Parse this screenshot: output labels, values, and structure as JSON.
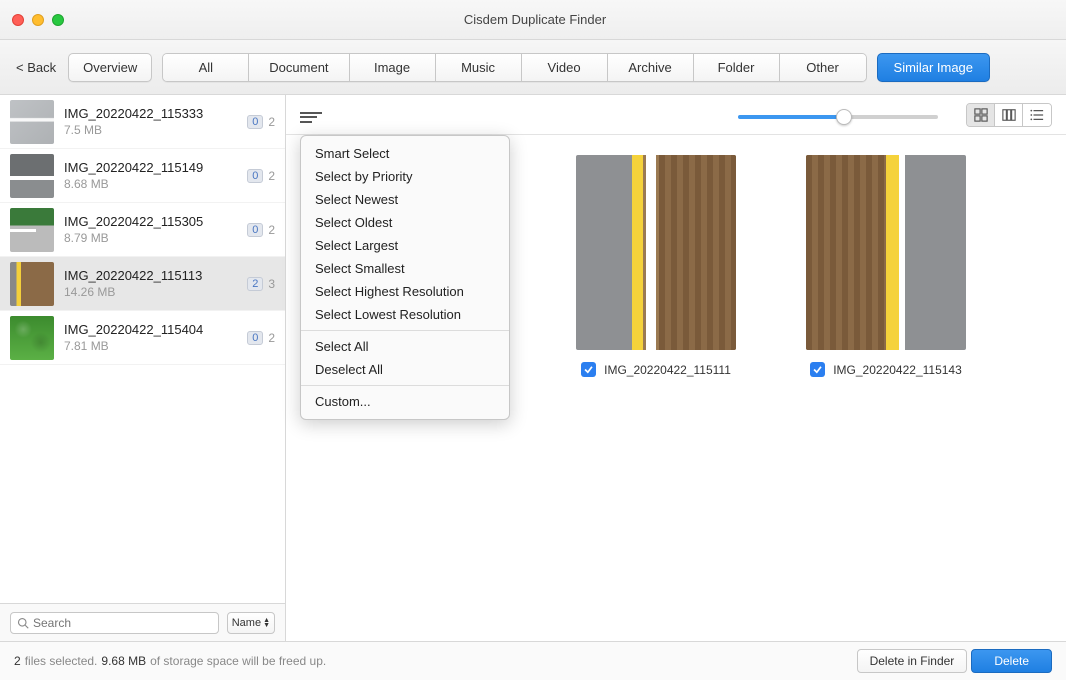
{
  "window": {
    "title": "Cisdem Duplicate Finder"
  },
  "toolbar": {
    "back": "< Back",
    "overview": "Overview",
    "tabs": [
      "All",
      "Document",
      "Image",
      "Music",
      "Video",
      "Archive",
      "Folder",
      "Other"
    ],
    "similar_image": "Similar Image"
  },
  "sidebar": {
    "items": [
      {
        "name": "IMG_20220422_115333",
        "size": "7.5 MB",
        "selected": "0",
        "total": "2"
      },
      {
        "name": "IMG_20220422_115149",
        "size": "8.68 MB",
        "selected": "0",
        "total": "2"
      },
      {
        "name": "IMG_20220422_115305",
        "size": "8.79 MB",
        "selected": "0",
        "total": "2"
      },
      {
        "name": "IMG_20220422_115113",
        "size": "14.26 MB",
        "selected": "2",
        "total": "3"
      },
      {
        "name": "IMG_20220422_115404",
        "size": "7.81 MB",
        "selected": "0",
        "total": "2"
      }
    ],
    "search_placeholder": "Search",
    "sort_label": "Name"
  },
  "dropdown": {
    "items": [
      "Smart Select",
      "Select by Priority",
      "Select Newest",
      "Select Oldest",
      "Select Largest",
      "Select Smallest",
      "Select Highest Resolution",
      "Select Lowest Resolution"
    ],
    "items2": [
      "Select All",
      "Deselect All"
    ],
    "items3": [
      "Custom..."
    ]
  },
  "grid": {
    "cards": [
      {
        "filename": "IMG_20220422_115111",
        "checked": true
      },
      {
        "filename": "IMG_20220422_115143",
        "checked": true
      }
    ]
  },
  "status": {
    "count": "2",
    "text_a": " files selected. ",
    "size": "9.68 MB",
    "text_b": " of storage space will be freed up.",
    "delete_in_finder": "Delete in Finder",
    "delete": "Delete"
  }
}
